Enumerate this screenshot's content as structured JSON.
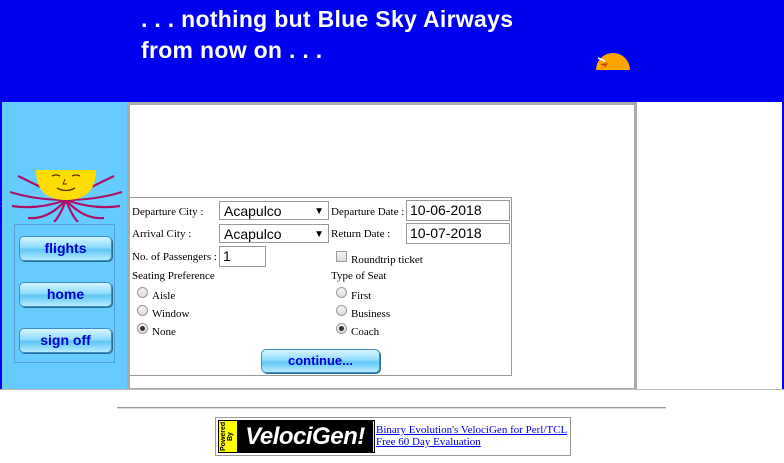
{
  "banner": {
    "line1": ". . . nothing but Blue Sky Airways",
    "line2": "from now on . . ."
  },
  "nav": {
    "flights_label": "flights",
    "home_label": "home",
    "signoff_label": "sign off"
  },
  "form": {
    "departure_city_label": "Departure City :",
    "departure_city_value": "Acapulco",
    "arrival_city_label": "Arrival City :",
    "arrival_city_value": "Acapulco",
    "departure_date_label": "Departure Date :",
    "departure_date_value": "10-06-2018",
    "return_date_label": "Return Date :",
    "return_date_value": "10-07-2018",
    "passengers_label": "No. of Passengers :",
    "passengers_value": "1",
    "roundtrip_label": "Roundtrip ticket",
    "roundtrip_checked": false,
    "seating_pref_label": "Seating Preference",
    "seating_options": [
      {
        "label": "Aisle",
        "selected": false
      },
      {
        "label": "Window",
        "selected": false
      },
      {
        "label": "None",
        "selected": true
      }
    ],
    "seat_type_label": "Type of Seat",
    "seat_type_options": [
      {
        "label": "First",
        "selected": false
      },
      {
        "label": "Business",
        "selected": false
      },
      {
        "label": "Coach",
        "selected": true
      }
    ],
    "continue_label": "continue..."
  },
  "footer": {
    "logo_powered": "Powered By",
    "logo_name": "VelociGen!",
    "link1": "Binary Evolution's VelociGen for Perl/TCL",
    "link2": "Free 60 Day Evaluation"
  },
  "colors": {
    "banner_bg": "#0000f0",
    "sidebar_bg": "#66ccff",
    "link": "#0000ee"
  }
}
